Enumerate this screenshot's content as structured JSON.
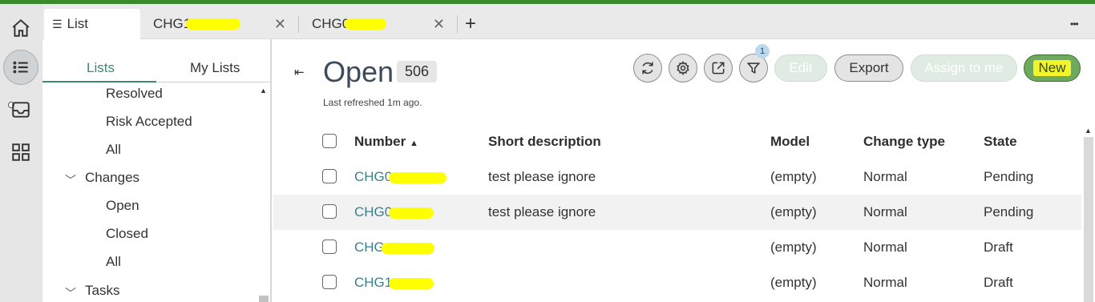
{
  "tabs": [
    {
      "label": "List",
      "active": true
    },
    {
      "label": "CHG1",
      "redacted": true
    },
    {
      "label": "CHG0",
      "redacted": true
    }
  ],
  "tab_add_label": "+",
  "more_label": "•••",
  "lists_panel": {
    "tabs": [
      "Lists",
      "My Lists"
    ],
    "items": [
      {
        "label": "Resolved",
        "level": 2
      },
      {
        "label": "Risk Accepted",
        "level": 2
      },
      {
        "label": "All",
        "level": 2
      },
      {
        "label": "Changes",
        "level": 1,
        "expanded": true
      },
      {
        "label": "Open",
        "level": 2
      },
      {
        "label": "Closed",
        "level": 2
      },
      {
        "label": "All",
        "level": 2
      },
      {
        "label": "Tasks",
        "level": 1,
        "expanded": true
      }
    ]
  },
  "main": {
    "title": "Open",
    "count": "506",
    "refresh_note": "Last refreshed 1m ago.",
    "filter_count": "1",
    "buttons": {
      "edit": "Edit",
      "export": "Export",
      "assign": "Assign to me",
      "new": "New"
    },
    "columns": [
      "Number",
      "Short description",
      "Model",
      "Change type",
      "State"
    ],
    "sort_indicator": "▲",
    "rows": [
      {
        "number": "CHG0",
        "short_description": "test please ignore",
        "model": "(empty)",
        "change_type": "Normal",
        "state": "Pending"
      },
      {
        "number": "CHG0",
        "short_description": "test please ignore",
        "model": "(empty)",
        "change_type": "Normal",
        "state": "Pending"
      },
      {
        "number": "CHG",
        "short_description": "",
        "model": "(empty)",
        "change_type": "Normal",
        "state": "Draft"
      },
      {
        "number": "CHG1",
        "short_description": "",
        "model": "(empty)",
        "change_type": "Normal",
        "state": "Draft"
      }
    ]
  },
  "colors": {
    "accent": "#3a8a76",
    "link": "#3b7f8a",
    "top_bar": "#3b8a2c",
    "primary_button": "#6ea95d",
    "redaction_highlight": "#ffff00"
  },
  "icons": {
    "rail": [
      "home-icon",
      "list-icon",
      "inbox-icon",
      "grid-icon"
    ],
    "toolbar": [
      "refresh-icon",
      "settings-icon",
      "share-icon",
      "filter-icon"
    ]
  }
}
